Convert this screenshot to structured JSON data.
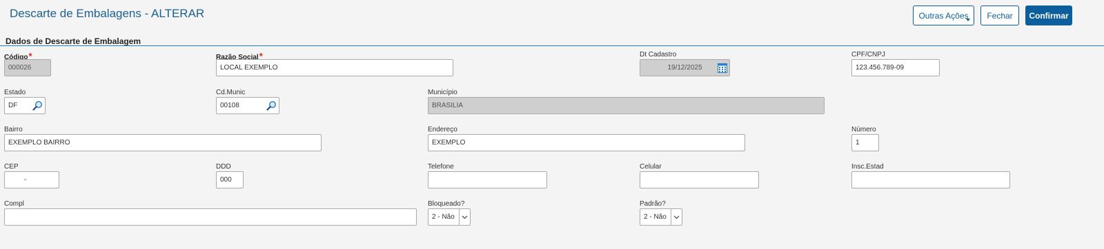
{
  "header": {
    "title": "Descarte de Embalagens - ALTERAR",
    "buttons": {
      "outras_acoes": "Outras Ações",
      "fechar": "Fechar",
      "confirmar": "Confirmar"
    }
  },
  "section": {
    "title": "Dados de Descarte de Embalagem"
  },
  "fields": {
    "codigo": {
      "label": "Código",
      "value": "000026",
      "required": true
    },
    "razao_social": {
      "label": "Razão Social",
      "value": "LOCAL EXEMPLO",
      "required": true
    },
    "dt_cadastro": {
      "label": "Dt Cadastro",
      "value": "19/12/2025"
    },
    "cpf_cnpj": {
      "label": "CPF/CNPJ",
      "value": "123.456.789-09"
    },
    "estado": {
      "label": "Estado",
      "value": "DF"
    },
    "cd_munic": {
      "label": "Cd.Munic",
      "value": "00108"
    },
    "municipio": {
      "label": "Município",
      "value": "BRASILIA"
    },
    "bairro": {
      "label": "Bairro",
      "value": "EXEMPLO BAIRRO"
    },
    "endereco": {
      "label": "Endereço",
      "value": "EXEMPLO"
    },
    "numero": {
      "label": "Número",
      "value": "1"
    },
    "cep": {
      "label": "CEP",
      "value": "     -"
    },
    "ddd": {
      "label": "DDD",
      "value": "000"
    },
    "telefone": {
      "label": "Telefone",
      "value": ""
    },
    "celular": {
      "label": "Celular",
      "value": ""
    },
    "insc_estad": {
      "label": "Insc.Estad",
      "value": ""
    },
    "compl": {
      "label": "Compl",
      "value": ""
    },
    "bloqueado": {
      "label": "Bloqueado?",
      "value": "2 - Não"
    },
    "padrao": {
      "label": "Padrão?",
      "value": "2 - Não"
    }
  },
  "icons": {
    "lookup": "magnifier-icon",
    "calendar": "calendar-icon",
    "dropdown": "chevron-down-icon"
  },
  "colors": {
    "accent": "#0c5f9c",
    "title": "#1c5f93",
    "required": "#d9261c",
    "readonly_bg": "#cfcfcf"
  }
}
